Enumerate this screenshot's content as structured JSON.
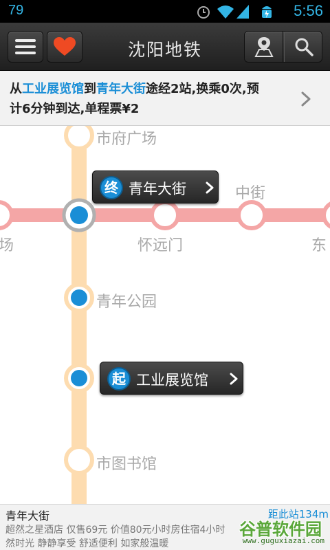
{
  "status_bar": {
    "left_number": "79",
    "time": "5:56"
  },
  "header": {
    "title": "沈阳地铁"
  },
  "route": {
    "from_prefix": "从",
    "from_station": "工业展览馆",
    "to_word": "到",
    "to_station": "青年大街",
    "line1_tail": "途经2站,换乘0次,预",
    "line2": "计6分钟到达,单程票¥2"
  },
  "map": {
    "line1_color": "#f4a6a6",
    "line2_color": "#fddcb0",
    "accent": "#1a8ed6",
    "stations": {
      "shifu": "市府广场",
      "huaiyuanmen": "怀远门",
      "zhongjie": "中街",
      "left_edge": "场",
      "right_edge": "东",
      "qingnian_gongyuan": "青年公园",
      "shi_tushuguan": "市图书馆"
    },
    "end_callout": {
      "badge": "终",
      "label": "青年大街"
    },
    "start_callout": {
      "badge": "起",
      "label": "工业展览馆"
    }
  },
  "bottom": {
    "title": "青年大街",
    "distance": "距此站134m",
    "ad_line1": "超然之星酒店 仅售69元 价值80元小时房住宿4小时",
    "ad_line2": "然时光 静静享受 舒适便利 如家般温暖"
  },
  "watermark": {
    "main": "谷普软件园",
    "sub": "www.guguxiazai.com"
  }
}
